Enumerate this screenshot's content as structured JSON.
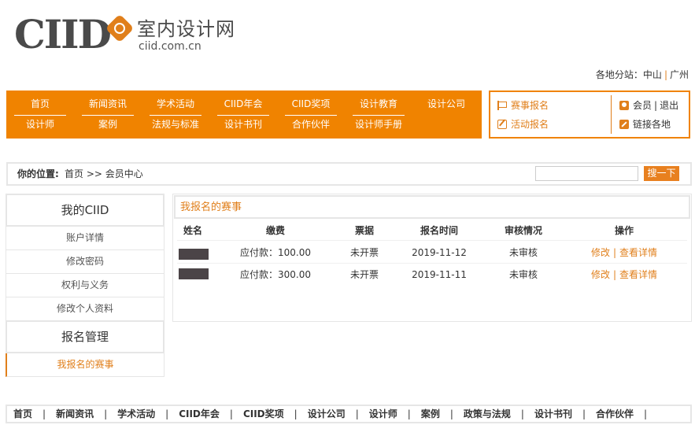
{
  "logo": {
    "brand": "CIID",
    "cn_name": "室内设计网",
    "domain": "ciid.com.cn"
  },
  "branch": {
    "label": "各地分站：",
    "sites": [
      "中山",
      "广州"
    ]
  },
  "nav": {
    "row1": [
      "首页",
      "新闻资讯",
      "学术活动",
      "CIID年会",
      "CIID奖项",
      "设计教育",
      "设计公司"
    ],
    "row2": [
      "设计师",
      "案例",
      "法规与标准",
      "设计书刊",
      "合作伙伴",
      "设计师手册"
    ]
  },
  "user_box": {
    "contest_signup": "赛事报名",
    "activity_signup": "活动报名",
    "member": "会员",
    "logout": "退出",
    "member_sep": "|",
    "local_links": "链接各地"
  },
  "location": {
    "label": "你的位置:",
    "path": "首页 >> 会员中心"
  },
  "search": {
    "value": "",
    "button": "搜一下"
  },
  "sidebar": {
    "section1": "我的CIID",
    "items1": [
      "账户详情",
      "修改密码",
      "权利与义务",
      "修改个人资料"
    ],
    "section2": "报名管理",
    "items2": [
      "我报名的赛事"
    ]
  },
  "main": {
    "title": "我报名的赛事",
    "columns": [
      "姓名",
      "缴费",
      "票据",
      "报名时间",
      "审核情况",
      "操作"
    ],
    "rows": [
      {
        "fee": "应付款：100.00",
        "invoice": "未开票",
        "date": "2019-11-12",
        "status": "未审核",
        "edit": "修改",
        "detail": "查看详情"
      },
      {
        "fee": "应付款：300.00",
        "invoice": "未开票",
        "date": "2019-11-11",
        "status": "未审核",
        "edit": "修改",
        "detail": "查看详情"
      }
    ]
  },
  "footer": [
    "首页",
    "新闻资讯",
    "学术活动",
    "CIID年会",
    "CIID奖项",
    "设计公司",
    "设计师",
    "案例",
    "政策与法规",
    "设计书刊",
    "合作伙伴"
  ],
  "colors": {
    "accent": "#f08300",
    "border": "#e6e6e6",
    "text": "#333333"
  }
}
